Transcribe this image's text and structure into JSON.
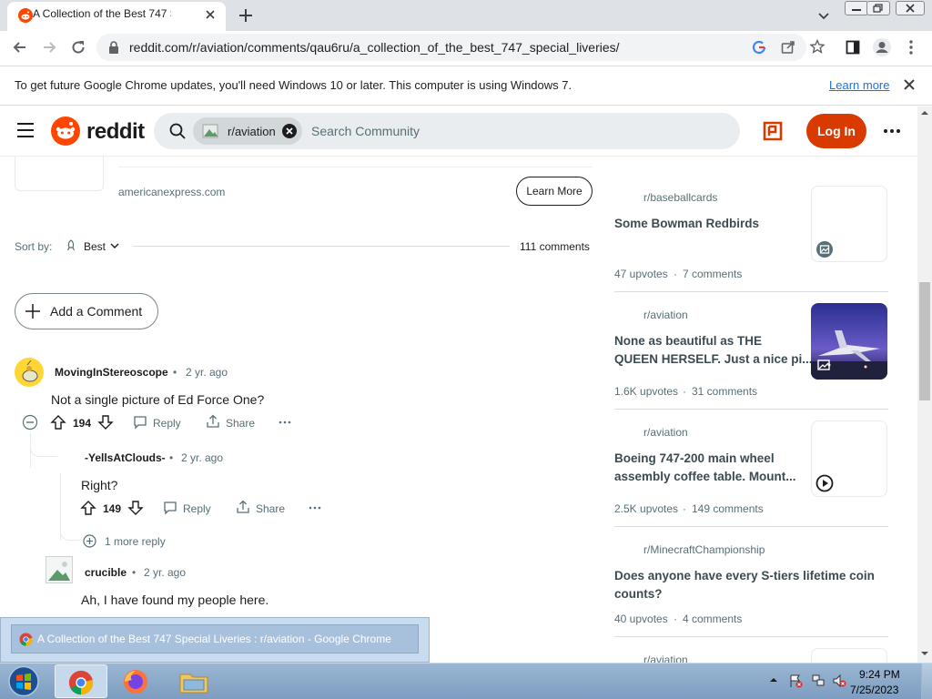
{
  "browser": {
    "tab_title": "A Collection of the Best 747 Special Liveries : r/aviation",
    "url": "reddit.com/r/aviation/comments/qau6ru/a_collection_of_the_best_747_special_liveries/",
    "info_bar": {
      "text": "To get future Google Chrome updates, you'll need Windows 10 or later. This computer is using Windows 7.",
      "link": "Learn more"
    }
  },
  "reddit_header": {
    "wordmark": "reddit",
    "community_chip": "r/aviation",
    "search_placeholder": "Search Community",
    "login": "Log In"
  },
  "ad": {
    "domain": "americanexpress.com",
    "cta": "Learn More"
  },
  "sort": {
    "label": "Sort by:",
    "value": "Best",
    "comment_count": "111 comments"
  },
  "add_comment": "Add a Comment",
  "comments": [
    {
      "author": "MovingInStereoscope",
      "age": "2 yr. ago",
      "text": "Not a single picture of Ed Force One?",
      "votes": "194",
      "reply": "Reply",
      "share": "Share"
    },
    {
      "author": "-YellsAtClouds-",
      "age": "2 yr. ago",
      "text": "Right?",
      "votes": "149",
      "reply": "Reply",
      "share": "Share",
      "more_replies": "1 more reply"
    },
    {
      "author": "crucible",
      "age": "2 yr. ago",
      "text": "Ah, I have found my people here."
    }
  ],
  "sidebar_posts": [
    {
      "subreddit": "r/baseballcards",
      "title_lines": [
        "Some Bowman Redbirds"
      ],
      "upvotes": "47 upvotes",
      "comments": "7 comments",
      "thumb": "image-icon"
    },
    {
      "subreddit": "r/aviation",
      "title_lines": [
        "None as beautiful as THE",
        "QUEEN HERSELF. Just a nice pi..."
      ],
      "upvotes": "1.6K upvotes",
      "comments": "31 comments",
      "thumb": "photo"
    },
    {
      "subreddit": "r/aviation",
      "title_lines": [
        "Boeing 747-200 main wheel",
        "assembly coffee table. Mount..."
      ],
      "upvotes": "2.5K upvotes",
      "comments": "149 comments",
      "thumb": "play-icon"
    },
    {
      "subreddit": "r/MinecraftChampionship",
      "title_lines": [
        "Does anyone have every S-tiers lifetime coin",
        "counts?"
      ],
      "upvotes": "40 upvotes",
      "comments": "4 comments"
    },
    {
      "subreddit": "r/aviation"
    }
  ],
  "taskbar": {
    "popup_title": "A Collection of the Best 747 Special Liveries : r/aviation - Google Chrome",
    "time": "9:24 PM",
    "date": "7/25/2023"
  }
}
